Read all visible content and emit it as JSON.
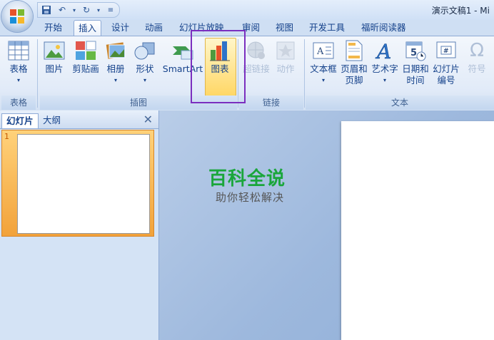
{
  "window": {
    "title": "演示文稿1 - Mi"
  },
  "qat": {
    "items": [
      "save-icon",
      "undo-icon",
      "redo-icon",
      "customize-icon"
    ]
  },
  "tabs": [
    "开始",
    "插入",
    "设计",
    "动画",
    "幻灯片放映",
    "审阅",
    "视图",
    "开发工具",
    "福昕阅读器"
  ],
  "active_tab": "插入",
  "ribbon": {
    "buttons": {
      "table": "表格",
      "picture": "图片",
      "clipart": "剪贴画",
      "album": "相册",
      "shapes": "形状",
      "smartart": "SmartArt",
      "chart": "图表",
      "hyperlink": "超链接",
      "action": "动作",
      "textbox": "文本框",
      "header_line1": "页眉和",
      "header_line2": "页脚",
      "wordart": "艺术字",
      "datetime_line1": "日期和",
      "datetime_line2": "时间",
      "slidenum_line1": "幻灯片",
      "slidenum_line2": "编号",
      "symbol": "符号"
    },
    "groups": {
      "tables": "表格",
      "illustrations": "插图",
      "links": "链接",
      "text": "文本"
    }
  },
  "pane": {
    "tab_slides": "幻灯片",
    "tab_outline": "大纲",
    "slide_number": "1"
  },
  "watermark": {
    "title": "百科全说",
    "subtitle": "助你轻松解决"
  },
  "colors": {
    "accent_purple": "#7b2fbf",
    "ribbon_blue": "#15428b",
    "watermark_green": "#1aa63b"
  }
}
